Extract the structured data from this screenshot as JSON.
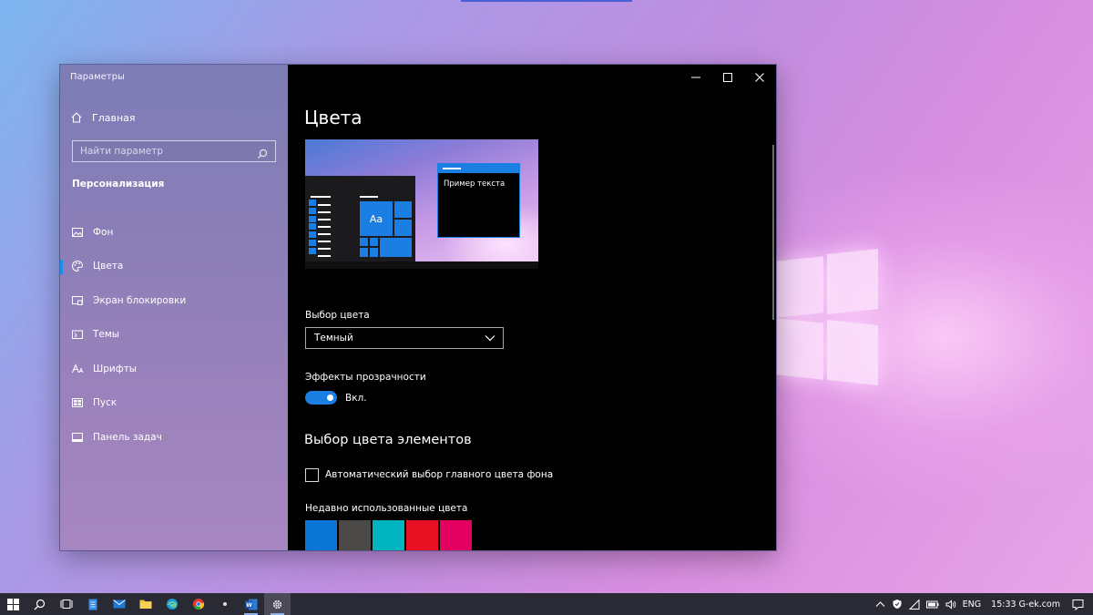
{
  "window": {
    "app_title": "Параметры",
    "controls": {
      "minimize": "─",
      "maximize": "☐",
      "close": "✕"
    }
  },
  "sidebar": {
    "home_label": "Главная",
    "search_placeholder": "Найти параметр",
    "section_title": "Персонализация",
    "items": [
      {
        "label": "Фон",
        "icon": "picture-icon"
      },
      {
        "label": "Цвета",
        "icon": "palette-icon",
        "active": true
      },
      {
        "label": "Экран блокировки",
        "icon": "lock-screen-icon"
      },
      {
        "label": "Темы",
        "icon": "themes-icon"
      },
      {
        "label": "Шрифты",
        "icon": "fonts-icon"
      },
      {
        "label": "Пуск",
        "icon": "start-icon"
      },
      {
        "label": "Панель задач",
        "icon": "taskbar-icon"
      }
    ]
  },
  "main": {
    "title": "Цвета",
    "preview": {
      "tile_label": "Aa",
      "sample_text": "Пример текста"
    },
    "color_choice_label": "Выбор цвета",
    "color_choice_value": "Темный",
    "transparency_label": "Эффекты прозрачности",
    "transparency_state": "Вкл.",
    "accent_heading": "Выбор цвета элементов",
    "auto_accent_label": "Автоматический выбор главного цвета фона",
    "recent_colors_label": "Недавно использованные цвета",
    "recent_colors": [
      "#0c76d6",
      "#4c4a48",
      "#00b4c0",
      "#e81123",
      "#e3005f"
    ]
  },
  "taskbar": {
    "language": "ENG",
    "clock": "15:33 G-ek.com",
    "apps": [
      "start-icon",
      "search-icon",
      "task-view-icon",
      "file-icon",
      "mail-icon",
      "folder-icon",
      "edge-icon",
      "chrome-icon",
      "app-dot-icon",
      "word-icon",
      "settings-icon"
    ]
  },
  "colors": {
    "accent": "#1a7ee3",
    "window_bg": "#000000",
    "taskbar_bg": "#2a2a35"
  }
}
